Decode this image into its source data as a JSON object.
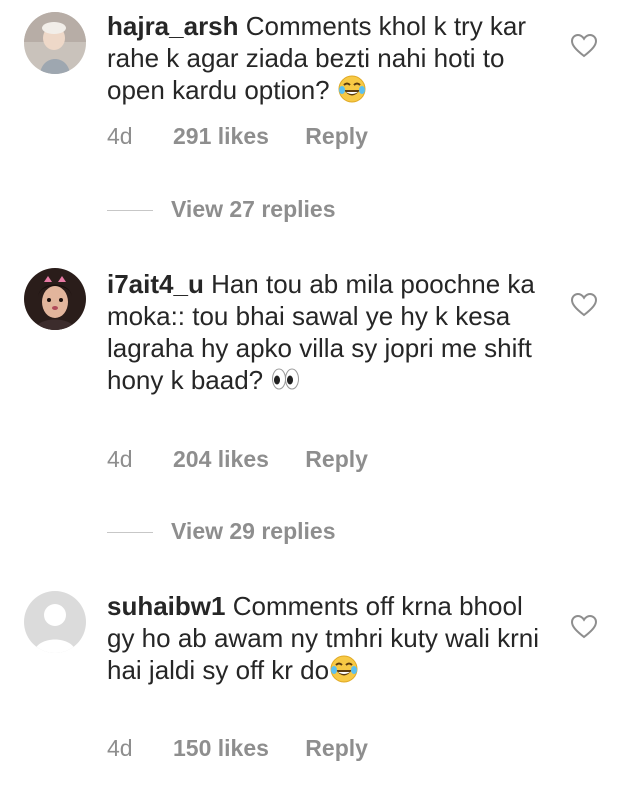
{
  "comments": [
    {
      "username": "hajra_arsh",
      "text": "Comments khol k try kar rahe k agar ziada bezti nahi hoti to open kardu option?",
      "emoji": "tears-of-joy-emoji",
      "time": "4d",
      "likes": "291 likes",
      "reply": "Reply",
      "view_replies": "View 27 replies"
    },
    {
      "username": "i7ait4_u",
      "text": "Han tou ab mila poochne ka moka:: tou bhai sawal ye hy k kesa lagraha hy apko villa sy jopri me shift hony k baad?",
      "emoji": "eyes-emoji",
      "time": "4d",
      "likes": "204 likes",
      "reply": "Reply",
      "view_replies": "View 29 replies"
    },
    {
      "username": "suhaibw1",
      "text": "Comments off krna bhool gy ho ab awam ny tmhri kuty wali krni hai jaldi sy off kr do",
      "emoji": "tears-of-joy-emoji",
      "time": "4d",
      "likes": "150 likes",
      "reply": "Reply"
    }
  ],
  "colors": {
    "text": "#262626",
    "meta": "#8e8e8e",
    "divider": "#c7c7c7",
    "heart_outline": "#8e8e8e",
    "emoji_yellow": "#f7c945"
  }
}
